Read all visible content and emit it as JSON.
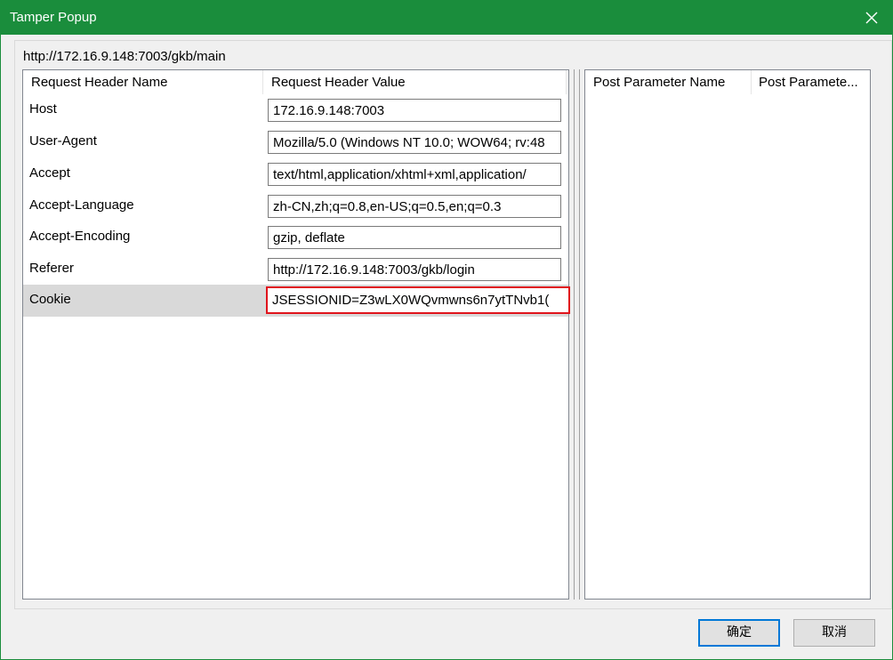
{
  "window": {
    "title": "Tamper Popup",
    "close_icon": "close-icon"
  },
  "url": "http://172.16.9.148:7003/gkb/main",
  "headers_table": {
    "columns": [
      "Request Header Name",
      "Request Header Value"
    ],
    "rows": [
      {
        "name": "Host",
        "value": "172.16.9.148:7003"
      },
      {
        "name": "User-Agent",
        "value": "Mozilla/5.0 (Windows NT 10.0; WOW64; rv:48"
      },
      {
        "name": "Accept",
        "value": "text/html,application/xhtml+xml,application/"
      },
      {
        "name": "Accept-Language",
        "value": "zh-CN,zh;q=0.8,en-US;q=0.5,en;q=0.3"
      },
      {
        "name": "Accept-Encoding",
        "value": "gzip, deflate"
      },
      {
        "name": "Referer",
        "value": "http://172.16.9.148:7003/gkb/login"
      },
      {
        "name": "Cookie",
        "value": "JSESSIONID=Z3wLX0WQvmwns6n7ytTNvb1("
      }
    ],
    "selected_row": "Cookie"
  },
  "post_table": {
    "columns": [
      "Post Parameter Name",
      "Post Paramete..."
    ]
  },
  "buttons": {
    "ok": "确定",
    "cancel": "取消"
  },
  "colors": {
    "titlebar": "#1a8d3c",
    "highlight_border": "#e0141c",
    "selected_row": "#d9d9d9"
  }
}
